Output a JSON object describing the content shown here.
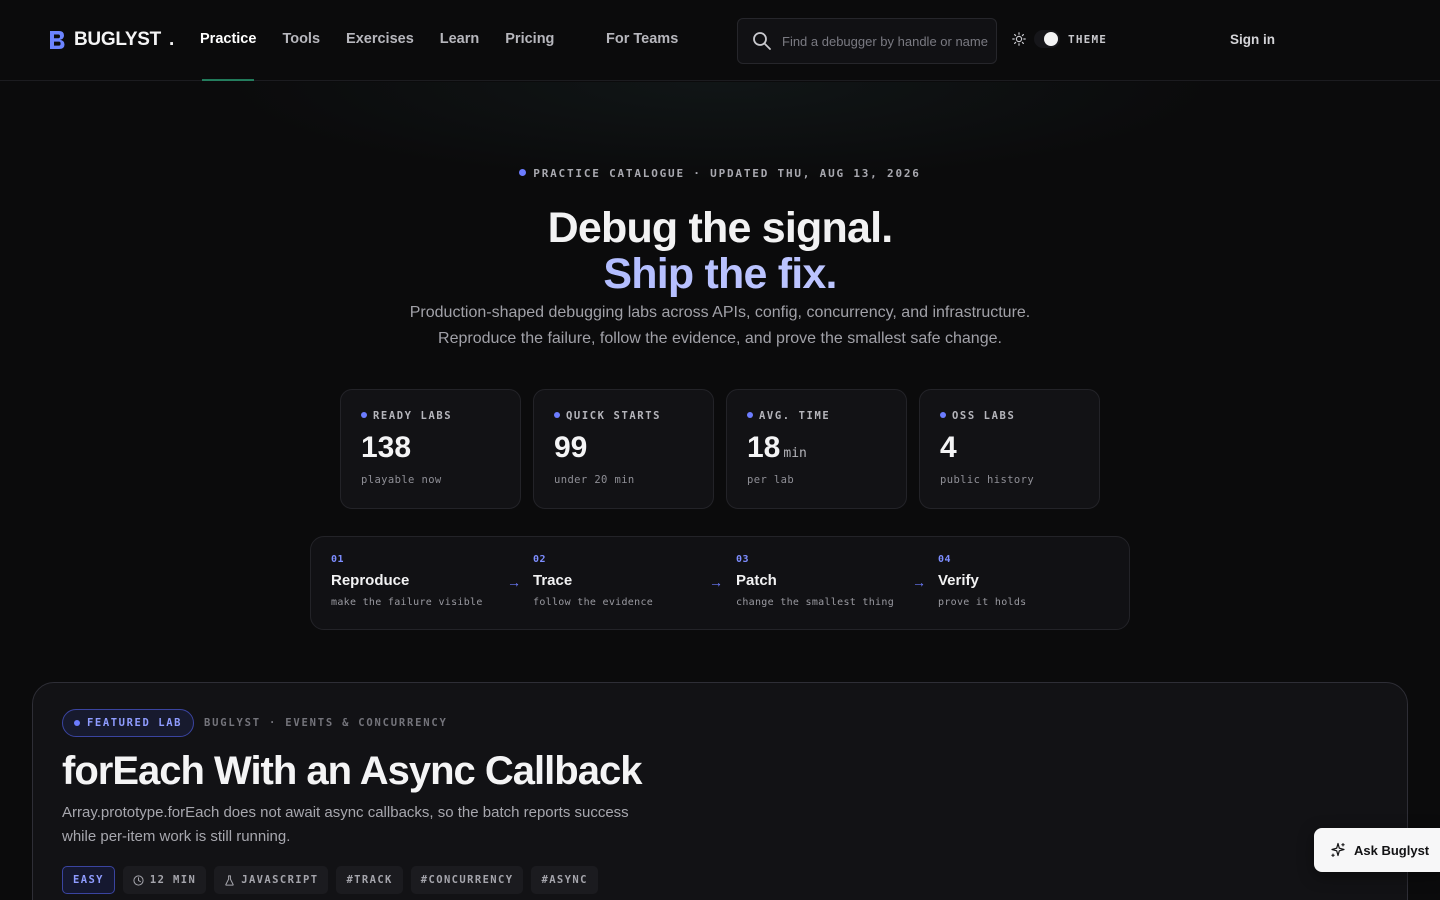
{
  "header": {
    "brand": "BUGLYST",
    "brand_suffix": ".",
    "nav": [
      {
        "label": "Practice",
        "active": true
      },
      {
        "label": "Tools"
      },
      {
        "label": "Exercises"
      },
      {
        "label": "Learn"
      },
      {
        "label": "Pricing"
      }
    ],
    "for_teams": "For Teams",
    "search_placeholder": "Find a debugger by handle or name",
    "theme_label": "THEME",
    "sign_in": "Sign in"
  },
  "hero": {
    "eyebrow": "PRACTICE CATALOGUE · UPDATED THU, AUG 13, 2026",
    "title_line1": "Debug the signal.",
    "title_line2": "Ship the fix.",
    "subtitle_line1": "Production-shaped debugging labs across APIs, config, concurrency, and infrastructure.",
    "subtitle_line2": "Reproduce the failure, follow the evidence, and prove the smallest safe change."
  },
  "stats": [
    {
      "label": "READY LABS",
      "value": "138",
      "unit": "",
      "caption": "playable now"
    },
    {
      "label": "QUICK STARTS",
      "value": "99",
      "unit": "",
      "caption": "under 20 min"
    },
    {
      "label": "AVG. TIME",
      "value": "18",
      "unit": "min",
      "caption": "per lab"
    },
    {
      "label": "OSS LABS",
      "value": "4",
      "unit": "",
      "caption": "public history"
    }
  ],
  "steps": [
    {
      "num": "01",
      "title": "Reproduce",
      "desc": "make the failure visible"
    },
    {
      "num": "02",
      "title": "Trace",
      "desc": "follow the evidence"
    },
    {
      "num": "03",
      "title": "Patch",
      "desc": "change the smallest thing"
    },
    {
      "num": "04",
      "title": "Verify",
      "desc": "prove it holds"
    }
  ],
  "featured": {
    "badge": "FEATURED LAB",
    "crumb": "BUGLYST · EVENTS & CONCURRENCY",
    "title": "forEach With an Async Callback",
    "desc_line1": "Array.prototype.forEach does not await async callbacks, so the batch reports success",
    "desc_line2": "while per-item work is still running.",
    "tags": [
      "EASY",
      "12 MIN",
      "JAVASCRIPT",
      "#TRACK",
      "#CONCURRENCY",
      "#ASYNC"
    ]
  },
  "ask_button": "Ask Buglyst",
  "colors": {
    "accent": "#6c7cff",
    "background": "#0b0b0c",
    "nav_underline": "#2aa87a"
  }
}
